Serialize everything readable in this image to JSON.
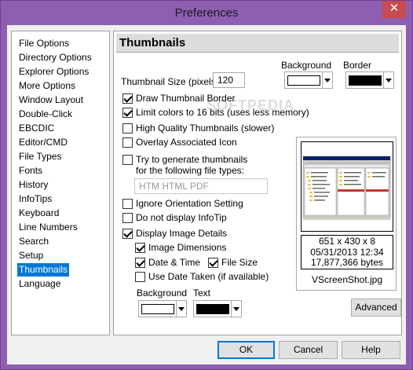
{
  "window": {
    "title": "Preferences",
    "close_glyph": "✕"
  },
  "nav": {
    "items": [
      "File Options",
      "Directory Options",
      "Explorer Options",
      "More Options",
      "Window Layout",
      "Double-Click",
      "EBCDIC",
      "Editor/CMD",
      "File Types",
      "Fonts",
      "History",
      "InfoTips",
      "Keyboard",
      "Line Numbers",
      "Search",
      "Setup",
      "Thumbnails",
      "Language"
    ],
    "selected": "Thumbnails"
  },
  "panel": {
    "title": "Thumbnails",
    "thumbnail_size_label": "Thumbnail Size (pixels)",
    "thumbnail_size_value": "120",
    "background_label": "Background",
    "border_label": "Border",
    "draw_border_label": "Draw Thumbnail Border",
    "limit_colors_label": "Limit colors to 16 bits (uses less memory)",
    "high_quality_label": "High Quality Thumbnails (slower)",
    "overlay_icon_label": "Overlay Associated Icon",
    "try_generate_label_1": "Try to generate thumbnails",
    "try_generate_label_2": "for the following file types:",
    "file_types_value": "HTM HTML PDF",
    "ignore_orientation_label": "Ignore Orientation Setting",
    "no_infotip_label": "Do not display InfoTip",
    "display_details_label": "Display Image Details",
    "image_dimensions_label": "Image Dimensions",
    "date_time_label": "Date & Time",
    "file_size_label": "File Size",
    "use_date_taken_label": "Use Date Taken (if available)",
    "text_background_label": "Background",
    "text_color_label": "Text",
    "checks": {
      "draw_border": true,
      "limit_colors": true,
      "high_quality": false,
      "overlay_icon": false,
      "try_generate": false,
      "ignore_orientation": false,
      "no_infotip": false,
      "display_details": true,
      "image_dimensions": true,
      "date_time": true,
      "file_size": true,
      "use_date_taken": false
    },
    "colors": {
      "thumb_background": "#ffffff",
      "thumb_border": "#000000",
      "text_background": "#ffffff",
      "text_color": "#000000"
    },
    "preview": {
      "dimensions": "651 x 430 x 8",
      "datetime": "05/31/2013 12:34",
      "size": "17,877,366 bytes",
      "filename": "VScreenShot.jpg"
    },
    "advanced_label": "Advanced"
  },
  "footer": {
    "ok_label": "OK",
    "cancel_label": "Cancel",
    "help_label": "Help"
  },
  "watermark": "SOFTPEDIA"
}
